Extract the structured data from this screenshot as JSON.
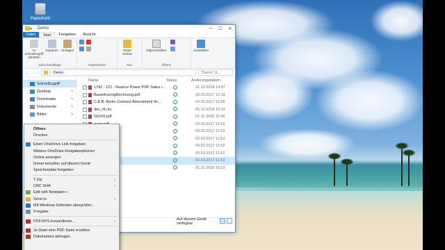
{
  "desktop": {
    "recycle_bin_label": "Papierkorb"
  },
  "window": {
    "title": "Demo"
  },
  "ribbon": {
    "tabs": [
      "Datei",
      "Start",
      "Freigeben",
      "Ansicht"
    ],
    "groups": [
      {
        "name": "Zwischenablage",
        "items": [
          "An Schnellzugriff anheften",
          "Kopieren",
          "Einfügen"
        ]
      },
      {
        "name": "Organisieren",
        "items": []
      },
      {
        "name": "Neu",
        "items": [
          "Neuer Ordner"
        ]
      },
      {
        "name": "Öffnen",
        "items": [
          "Eigenschaften"
        ]
      },
      {
        "name": "",
        "items": [
          "Auswählen"
        ]
      }
    ]
  },
  "address": {
    "path": "Demo",
    "search_placeholder": "\"Demo\" d..."
  },
  "nav": {
    "items": [
      {
        "label": "Schnellzugriff",
        "icon": "star-icon",
        "color": "#2c7fd6",
        "pinned": false
      },
      {
        "label": "Desktop",
        "icon": "desktop-icon",
        "color": "#2f87d8",
        "pinned": true
      },
      {
        "label": "Downloads",
        "icon": "download-icon",
        "color": "#2f87d8",
        "pinned": true
      },
      {
        "label": "Dokumente",
        "icon": "document-icon",
        "color": "#8b8b8b",
        "pinned": true
      },
      {
        "label": "Bilder",
        "icon": "picture-icon",
        "color": "#4a9fe0",
        "pinned": true
      }
    ]
  },
  "files": {
    "headers": {
      "name": "Name",
      "status": "Status",
      "date": "Änderungsdatum"
    },
    "rows": [
      {
        "name": "1792 - 121 - Nuance Power PDF Sales i...",
        "date": "31.10.2018 14:07",
        "selected": false
      },
      {
        "name": "BauerKoenigRechnung.pdf",
        "date": "03.03.2017 12:18",
        "selected": false
      },
      {
        "name": "C.E.B. Berlin Contract Amendment fin...",
        "date": "03.03.2017 11:58",
        "selected": false
      },
      {
        "name": "dev_rfc.trc",
        "date": "05.12.2018 15:33",
        "selected": false
      },
      {
        "name": "G0100.pdf",
        "date": "01.11.2018 15:48",
        "selected": false
      },
      {
        "name": "nung.pdf",
        "date": "03.03.2017 11:52",
        "selected": false
      },
      {
        "name": "ild.tif",
        "date": "03.03.2017 11:53",
        "selected": false
      },
      {
        "name": "chein.pdf",
        "date": "03.03.2017 11:53",
        "selected": false
      },
      {
        "name": "on.pdf",
        "date": "03.03.2017 11:52",
        "selected": false
      },
      {
        "name": "echnung.pdf",
        "date": "03.03.2017 11:52",
        "selected": false
      },
      {
        "name": "ung.pdf",
        "date": "03.03.2017 11:53",
        "selected": true
      },
      {
        "name": "df",
        "date": "01.11.2018 15:13",
        "selected": false
      }
    ],
    "status_text": "Auf diesem Gerät verfügbar"
  },
  "context_menu": {
    "items": [
      {
        "label": "Öffnen",
        "bold": true
      },
      {
        "label": "Drucken"
      },
      {
        "sep": true
      },
      {
        "label": "Einen OneDrive-Link freigeben",
        "icon": "cloud-icon"
      },
      {
        "label": "Weitere OneDrive-Freigabeoptionen"
      },
      {
        "label": "Online anzeigen"
      },
      {
        "label": "Immer behalten auf diesem Gerät"
      },
      {
        "label": "Speicherplatz freigeben"
      },
      {
        "sep": true
      },
      {
        "label": "7-Zip",
        "submenu": true
      },
      {
        "label": "CRC SHA",
        "submenu": true
      },
      {
        "label": "Edit with Notepad++",
        "icon": "notepad-icon"
      },
      {
        "label": "Send to",
        "icon": "send-icon",
        "submenu": true
      },
      {
        "label": "Mit Windows Defender überprüfen...",
        "icon": "shield-icon"
      },
      {
        "label": "Freigabe",
        "icon": "share-icon"
      },
      {
        "sep": true
      },
      {
        "label": "PDF/XPS konvertieren...",
        "icon": "pdf-icon",
        "submenu": true
      },
      {
        "sep": true
      },
      {
        "label": "Je Datei eine PDF-Datei erstellen",
        "icon": "pdf-icon"
      },
      {
        "label": "Dateinamen abfragen",
        "icon": "pdf-icon"
      }
    ]
  }
}
